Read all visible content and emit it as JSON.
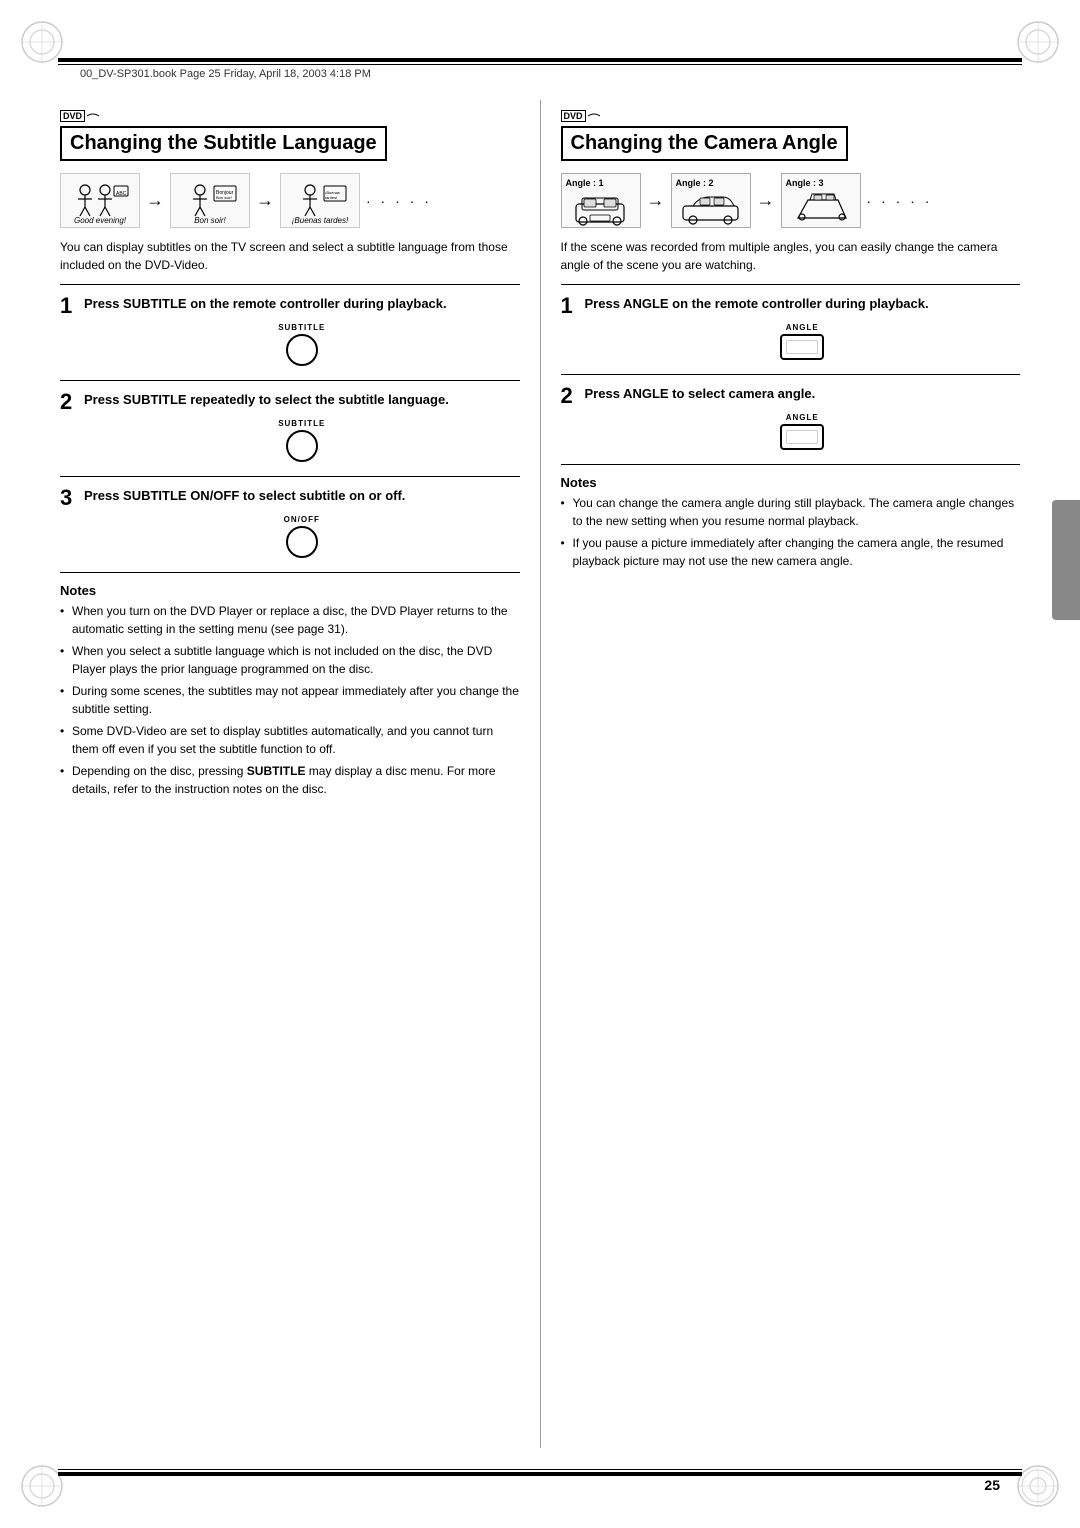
{
  "page": {
    "file_info": "00_DV-SP301.book  Page 25  Friday, April 18, 2003  4:18 PM",
    "page_number": "25"
  },
  "left_section": {
    "dvd_label": "DVD",
    "title": "Changing the Subtitle Language",
    "description": "You can display subtitles on the TV screen and select a subtitle language from those included on the DVD-Video.",
    "step1_number": "1",
    "step1_text": "Press SUBTITLE on the remote controller during playback.",
    "step2_number": "2",
    "step2_text": "Press SUBTITLE repeatedly to select the subtitle language.",
    "step3_number": "3",
    "step3_text": "Press SUBTITLE ON/OFF to select subtitle on or off.",
    "notes_title": "Notes",
    "notes": [
      "When you turn on the DVD Player or replace a disc, the DVD Player returns to the automatic setting in the setting menu (see page 31).",
      "When you select a subtitle language which is not included on the disc, the DVD Player plays the prior language programmed on the disc.",
      "During some scenes, the subtitles may not appear immediately after you change the subtitle setting.",
      "Some DVD-Video are set to display subtitles automatically, and you cannot turn them off even if you set the subtitle function to off.",
      "Depending on the disc, pressing SUBTITLE may display a disc menu. For more details, refer to the instruction notes on the disc."
    ],
    "illus_captions": [
      "Good evening!",
      "Bon soir!",
      "¡Buenas tardes!"
    ],
    "button1_label": "SUBTITLE",
    "button2_label": "SUBTITLE",
    "button3_label": "ON/OFF"
  },
  "right_section": {
    "dvd_label": "DVD",
    "title": "Changing the Camera Angle",
    "description": "If the scene was recorded from multiple angles, you can easily change the camera angle of the scene you are watching.",
    "step1_number": "1",
    "step1_text": "Press ANGLE on the remote controller during playback.",
    "step2_number": "2",
    "step2_text": "Press ANGLE to select camera angle.",
    "notes_title": "Notes",
    "notes": [
      "You can change the camera angle during still playback. The camera angle changes to the new setting when you resume normal playback.",
      "If you pause a picture immediately after changing the camera angle, the resumed playback picture may not use the new camera angle."
    ],
    "angle_labels": [
      "Angle : 1",
      "Angle : 2",
      "Angle : 3"
    ],
    "button1_label": "ANGLE",
    "button2_label": "ANGLE"
  }
}
